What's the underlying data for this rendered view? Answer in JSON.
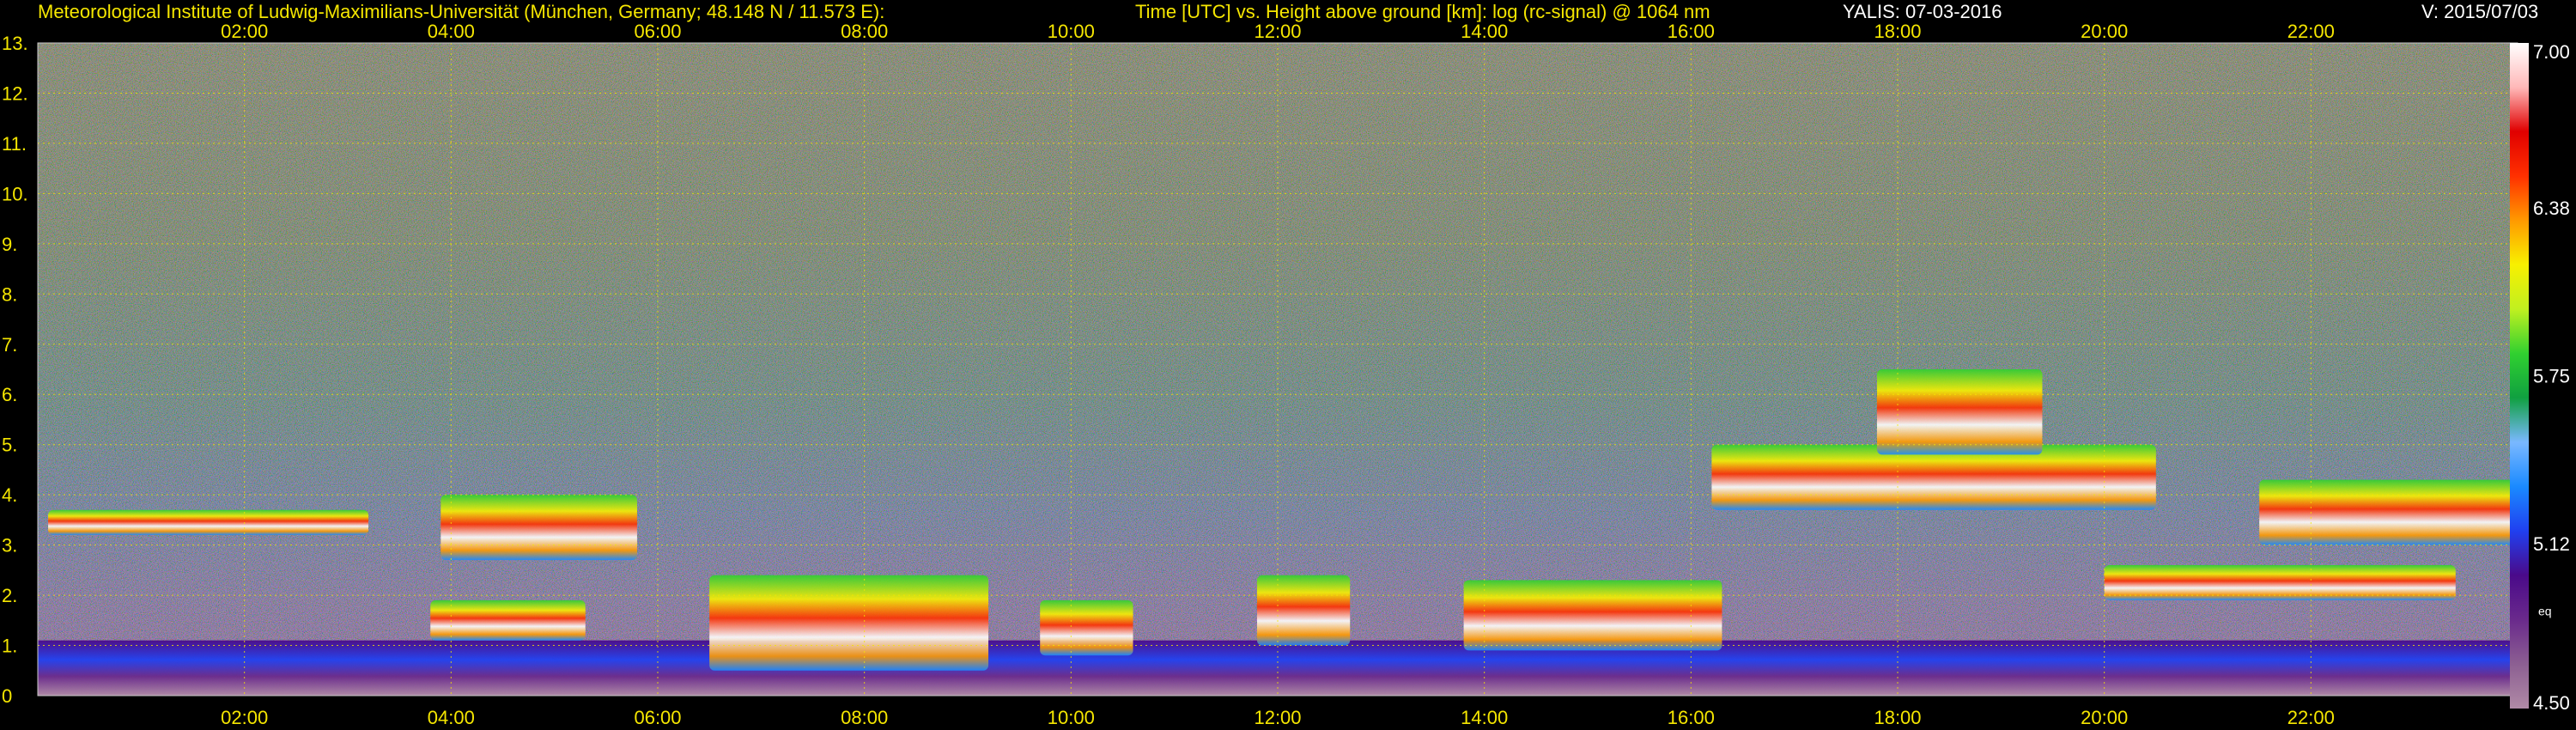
{
  "header": {
    "institute": "Meteorological Institute of Ludwig-Maximilians-Universität (München, Germany; 48.148 N / 11.573 E):",
    "description": "Time [UTC] vs. Height above ground [km]: log (rc-signal) @ 1064 nm",
    "station_date": "YALIS: 07-03-2016",
    "version": "V: 2015/07/03"
  },
  "colors": {
    "header_text": "#f5e600",
    "grid": "#f5e600",
    "background": "#000000"
  },
  "chart_data": {
    "type": "heatmap",
    "title": "Time [UTC] vs. Height above ground [km]: log (rc-signal) @ 1064 nm",
    "x_range_hours": [
      0,
      24
    ],
    "x_ticks": [
      "02:00",
      "04:00",
      "06:00",
      "08:00",
      "10:00",
      "12:00",
      "14:00",
      "16:00",
      "18:00",
      "20:00",
      "22:00"
    ],
    "x_tick_hours": [
      2,
      4,
      6,
      8,
      10,
      12,
      14,
      16,
      18,
      20,
      22
    ],
    "y_range_km": [
      0,
      13
    ],
    "y_ticks": [
      "0",
      "1.",
      "2.",
      "3.",
      "4.",
      "5.",
      "6.",
      "7.",
      "8.",
      "9.",
      "10.",
      "11.",
      "12.",
      "13."
    ],
    "grid": true,
    "colorbar": {
      "range": [
        4.5,
        7.0
      ],
      "tick_labels": [
        "7.00",
        "6.38",
        "5.75",
        "5.12",
        "4.50"
      ],
      "tick_values": [
        7.0,
        6.38,
        5.75,
        5.12,
        4.5
      ],
      "extra_label": "eq",
      "stops": [
        "#b08aa6",
        "#8c5f92",
        "#6a2a8c",
        "#4a0a8a",
        "#2040f0",
        "#1a8aff",
        "#7ab8ff",
        "#10a040",
        "#30d030",
        "#c0f020",
        "#f8f000",
        "#ff9a00",
        "#ff3000",
        "#e00000",
        "#ffb8b8",
        "#ffffff"
      ]
    },
    "layers": [
      {
        "feature": "boundary layer / residual aerosol",
        "start_h": 0.0,
        "end_h": 24.0,
        "bottom_km": 0.0,
        "top_km": 1.1
      },
      {
        "feature": "cloud layer",
        "start_h": 0.1,
        "end_h": 3.2,
        "bottom_km": 3.2,
        "top_km": 3.7
      },
      {
        "feature": "cloud layer",
        "start_h": 3.9,
        "end_h": 5.8,
        "bottom_km": 2.7,
        "top_km": 4.0
      },
      {
        "feature": "cloud layer",
        "start_h": 3.8,
        "end_h": 5.3,
        "bottom_km": 1.1,
        "top_km": 1.9
      },
      {
        "feature": "cloud layer",
        "start_h": 6.5,
        "end_h": 9.2,
        "bottom_km": 0.5,
        "top_km": 2.4
      },
      {
        "feature": "cloud layer",
        "start_h": 9.7,
        "end_h": 10.6,
        "bottom_km": 0.8,
        "top_km": 1.9
      },
      {
        "feature": "cloud layer",
        "start_h": 11.8,
        "end_h": 12.7,
        "bottom_km": 1.0,
        "top_km": 2.4
      },
      {
        "feature": "cloud layer",
        "start_h": 13.8,
        "end_h": 16.3,
        "bottom_km": 0.9,
        "top_km": 2.3
      },
      {
        "feature": "cloud layer",
        "start_h": 16.2,
        "end_h": 20.5,
        "bottom_km": 3.7,
        "top_km": 5.0
      },
      {
        "feature": "cloud layer",
        "start_h": 17.8,
        "end_h": 19.4,
        "bottom_km": 4.8,
        "top_km": 6.5
      },
      {
        "feature": "cloud layer",
        "start_h": 20.0,
        "end_h": 23.4,
        "bottom_km": 1.9,
        "top_km": 2.6
      },
      {
        "feature": "cloud layer",
        "start_h": 21.5,
        "end_h": 24.0,
        "bottom_km": 3.0,
        "top_km": 4.3
      }
    ]
  }
}
